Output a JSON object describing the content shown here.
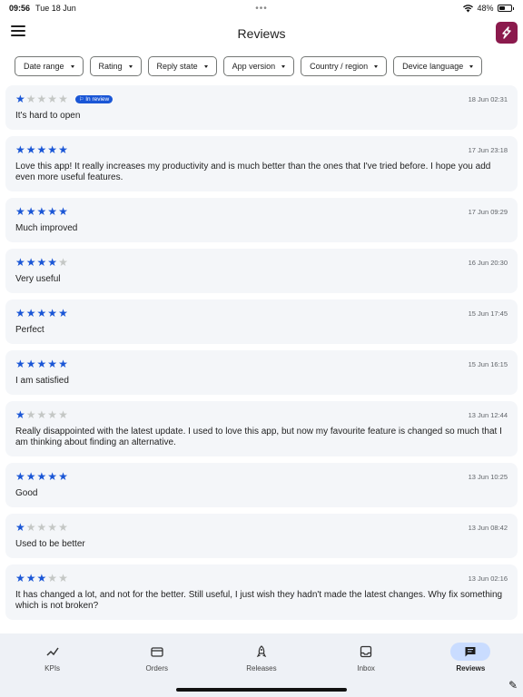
{
  "status_bar": {
    "time": "09:56",
    "date": "Tue 18 Jun",
    "dots": "•••",
    "battery": "48%",
    "battery_level": 0.48
  },
  "app_bar": {
    "title": "Reviews"
  },
  "filters": [
    {
      "label": "Date range"
    },
    {
      "label": "Rating"
    },
    {
      "label": "Reply state"
    },
    {
      "label": "App version"
    },
    {
      "label": "Country / region"
    },
    {
      "label": "Device language"
    }
  ],
  "colors": {
    "accent": "#1a56d6",
    "star_off": "#c4c7c5",
    "card_bg": "#f4f6f9",
    "nav_bg": "#eef1f6",
    "nav_active": "#c9dcff",
    "logo_bg": "#8b1a4d"
  },
  "reviews": [
    {
      "rating": 1,
      "badge": "In review",
      "date": "18 Jun 02:31",
      "text": "It's hard to open"
    },
    {
      "rating": 5,
      "date": "17 Jun 23:18",
      "text": "Love this app! It really increases my productivity and is much better than the ones that I've tried before. I hope you add even more useful features."
    },
    {
      "rating": 5,
      "date": "17 Jun 09:29",
      "text": "Much improved"
    },
    {
      "rating": 4,
      "date": "16 Jun 20:30",
      "text": "Very useful"
    },
    {
      "rating": 5,
      "date": "15 Jun 17:45",
      "text": "Perfect"
    },
    {
      "rating": 5,
      "date": "15 Jun 16:15",
      "text": "I am satisfied"
    },
    {
      "rating": 1,
      "date": "13 Jun 12:44",
      "text": "Really disappointed with the latest update. I used to love this app, but now my favourite feature is changed so much that I am thinking about finding an alternative."
    },
    {
      "rating": 5,
      "date": "13 Jun 10:25",
      "text": "Good"
    },
    {
      "rating": 1,
      "date": "13 Jun 08:42",
      "text": "Used to be better"
    },
    {
      "rating": 3,
      "date": "13 Jun 02:16",
      "text": "It has changed a lot, and not for the better. Still useful, I just wish they hadn't made the latest changes. Why fix something which is not broken?"
    }
  ],
  "bottom_nav": [
    {
      "label": "KPIs",
      "icon": "trending-up-icon",
      "active": false
    },
    {
      "label": "Orders",
      "icon": "credit-card-icon",
      "active": false
    },
    {
      "label": "Releases",
      "icon": "rocket-icon",
      "active": false
    },
    {
      "label": "Inbox",
      "icon": "inbox-icon",
      "active": false
    },
    {
      "label": "Reviews",
      "icon": "chat-icon",
      "active": true
    }
  ]
}
